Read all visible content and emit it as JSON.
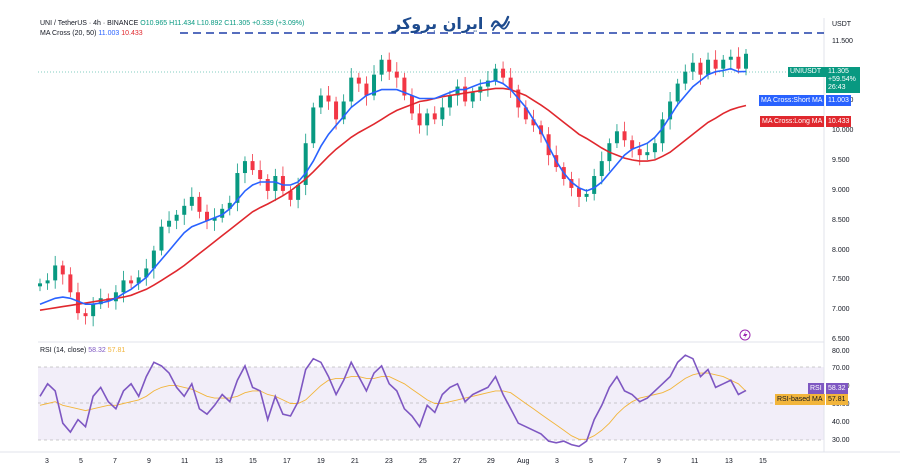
{
  "header": {
    "symbol": "UNI / TetherUS · 4h · BINANCE",
    "open": "O10.965",
    "high": "H11.434",
    "low": "L10.892",
    "close": "C11.305",
    "change": "+0.339 (+3.09%)",
    "ma_label": "MA Cross (20, 50)",
    "ma_short_val": "11.003",
    "ma_long_val": "10.433"
  },
  "logo": {
    "text": "ایران بروکر",
    "icon": "chart-trend-icon"
  },
  "price_axis": {
    "currency": "USDT",
    "ticks": [
      "11.500",
      "11.000",
      "10.500",
      "10.000",
      "9.500",
      "9.000",
      "8.500",
      "8.000",
      "7.500",
      "7.000",
      "6.500"
    ]
  },
  "rsi_axis": {
    "ticks": [
      "80.00",
      "70.00",
      "60.00",
      "50.00",
      "40.00",
      "30.00"
    ]
  },
  "tags": {
    "price": {
      "symbol": "UNIUSDT",
      "value": "11.305",
      "change": "+59.54%",
      "countdown": "26:43"
    },
    "ma_short": {
      "label": "MA Cross:Short MA",
      "value": "11.003"
    },
    "ma_long": {
      "label": "MA Cross:Long MA",
      "value": "10.433"
    },
    "rsi": {
      "label": "RSI",
      "value": "58.32"
    },
    "rsi_ma": {
      "label": "RSI-based MA",
      "value": "57.81"
    }
  },
  "rsi_header": {
    "label": "RSI (14, close)",
    "v1": "58.32",
    "v2": "57.81"
  },
  "x_axis": {
    "ticks": [
      "3",
      "5",
      "7",
      "9",
      "11",
      "13",
      "15",
      "17",
      "19",
      "21",
      "23",
      "25",
      "27",
      "29",
      "Aug",
      "3",
      "5",
      "7",
      "9",
      "11",
      "13",
      "15"
    ]
  },
  "colors": {
    "up": "#089981",
    "down": "#f23645",
    "ma_short": "#2962ff",
    "ma_long": "#e0282e",
    "rsi": "#7e57c2",
    "rsi_ma": "#f2b53c"
  },
  "chart_data": {
    "type": "candlestick",
    "price_ylim": [
      6.5,
      11.9
    ],
    "rsi_ylim": [
      25,
      82
    ],
    "close": [
      7.45,
      7.5,
      7.75,
      7.6,
      7.3,
      6.95,
      6.9,
      7.1,
      7.2,
      7.15,
      7.3,
      7.5,
      7.45,
      7.55,
      7.7,
      8.0,
      8.4,
      8.5,
      8.6,
      8.75,
      8.9,
      8.65,
      8.5,
      8.55,
      8.7,
      8.8,
      9.3,
      9.5,
      9.35,
      9.2,
      9.0,
      9.25,
      9.0,
      8.85,
      9.1,
      9.8,
      10.4,
      10.6,
      10.5,
      10.2,
      10.5,
      10.9,
      10.8,
      10.6,
      10.95,
      11.2,
      11.0,
      10.9,
      10.6,
      10.3,
      10.1,
      10.3,
      10.2,
      10.4,
      10.6,
      10.75,
      10.5,
      10.65,
      10.75,
      10.85,
      11.05,
      10.9,
      10.7,
      10.4,
      10.2,
      10.1,
      9.95,
      9.6,
      9.4,
      9.2,
      9.05,
      8.9,
      8.95,
      9.25,
      9.5,
      9.8,
      10.0,
      9.85,
      9.7,
      9.6,
      9.65,
      9.8,
      10.2,
      10.5,
      10.8,
      11.0,
      11.15,
      10.95,
      11.2,
      11.05,
      11.2,
      11.25,
      11.05,
      11.3
    ],
    "ma_short": [
      7.1,
      7.15,
      7.2,
      7.22,
      7.2,
      7.15,
      7.1,
      7.1,
      7.12,
      7.15,
      7.2,
      7.28,
      7.35,
      7.45,
      7.55,
      7.7,
      7.85,
      8.0,
      8.15,
      8.3,
      8.4,
      8.45,
      8.5,
      8.55,
      8.6,
      8.7,
      8.85,
      9.0,
      9.1,
      9.15,
      9.15,
      9.15,
      9.1,
      9.1,
      9.15,
      9.3,
      9.5,
      9.75,
      9.95,
      10.1,
      10.25,
      10.4,
      10.5,
      10.6,
      10.65,
      10.7,
      10.7,
      10.7,
      10.65,
      10.6,
      10.55,
      10.55,
      10.55,
      10.6,
      10.65,
      10.7,
      10.7,
      10.75,
      10.8,
      10.82,
      10.85,
      10.8,
      10.7,
      10.55,
      10.4,
      10.2,
      10.0,
      9.75,
      9.5,
      9.3,
      9.15,
      9.05,
      9.0,
      9.05,
      9.15,
      9.3,
      9.45,
      9.6,
      9.7,
      9.75,
      9.8,
      9.9,
      10.05,
      10.25,
      10.45,
      10.6,
      10.75,
      10.85,
      10.95,
      11.0,
      11.02,
      11.05,
      11.0,
      11.003
    ],
    "ma_long": [
      7.0,
      7.02,
      7.04,
      7.06,
      7.08,
      7.1,
      7.12,
      7.14,
      7.16,
      7.18,
      7.2,
      7.22,
      7.25,
      7.3,
      7.35,
      7.42,
      7.5,
      7.58,
      7.66,
      7.75,
      7.85,
      7.95,
      8.05,
      8.15,
      8.25,
      8.35,
      8.45,
      8.55,
      8.65,
      8.72,
      8.78,
      8.85,
      8.92,
      9.0,
      9.1,
      9.2,
      9.32,
      9.45,
      9.58,
      9.7,
      9.8,
      9.9,
      9.98,
      10.05,
      10.12,
      10.2,
      10.28,
      10.35,
      10.4,
      10.45,
      10.5,
      10.52,
      10.55,
      10.58,
      10.6,
      10.62,
      10.64,
      10.66,
      10.68,
      10.7,
      10.72,
      10.72,
      10.7,
      10.65,
      10.6,
      10.52,
      10.44,
      10.35,
      10.25,
      10.15,
      10.05,
      9.95,
      9.88,
      9.8,
      9.72,
      9.65,
      9.6,
      9.55,
      9.52,
      9.5,
      9.5,
      9.52,
      9.58,
      9.65,
      9.75,
      9.85,
      9.95,
      10.05,
      10.15,
      10.22,
      10.3,
      10.36,
      10.4,
      10.433
    ],
    "rsi": [
      55,
      62,
      58,
      40,
      35,
      42,
      38,
      55,
      60,
      52,
      48,
      58,
      62,
      55,
      66,
      74,
      72,
      68,
      60,
      55,
      62,
      48,
      45,
      50,
      56,
      52,
      64,
      72,
      60,
      58,
      42,
      55,
      45,
      44,
      52,
      70,
      76,
      74,
      66,
      56,
      64,
      74,
      66,
      58,
      68,
      72,
      62,
      58,
      48,
      44,
      38,
      50,
      46,
      56,
      60,
      62,
      52,
      56,
      58,
      60,
      66,
      56,
      48,
      40,
      38,
      36,
      34,
      30,
      29,
      30,
      28,
      27,
      30,
      42,
      50,
      60,
      66,
      58,
      56,
      52,
      54,
      58,
      62,
      66,
      74,
      78,
      76,
      66,
      70,
      60,
      62,
      64,
      56,
      58.32
    ],
    "rsi_ma": [
      50,
      51,
      52,
      50,
      49,
      48,
      47,
      48,
      49,
      50,
      50,
      51,
      52,
      53,
      55,
      58,
      60,
      61,
      61,
      60,
      59,
      57,
      55,
      54,
      54,
      54,
      55,
      57,
      58,
      58,
      56,
      55,
      53,
      51,
      51,
      53,
      57,
      61,
      64,
      65,
      65,
      66,
      66,
      65,
      65,
      66,
      66,
      64,
      62,
      59,
      56,
      53,
      51,
      51,
      52,
      53,
      54,
      55,
      56,
      57,
      58,
      58,
      57,
      54,
      51,
      48,
      45,
      42,
      39,
      36,
      33,
      31,
      31,
      33,
      36,
      40,
      45,
      49,
      52,
      54,
      55,
      56,
      57,
      59,
      62,
      65,
      67,
      68,
      68,
      67,
      66,
      64,
      62,
      57.81
    ]
  }
}
